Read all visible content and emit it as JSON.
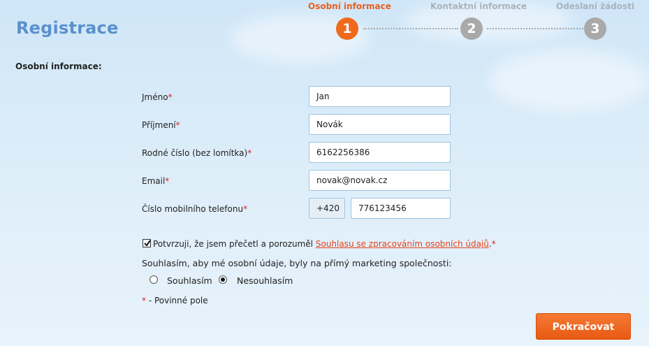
{
  "page": {
    "title": "Registrace"
  },
  "steps": [
    {
      "label": "Osobní informace",
      "number": "1",
      "state": "active"
    },
    {
      "label": "Kontaktní informace",
      "number": "2",
      "state": "inactive"
    },
    {
      "label": "Odeslaní žádosti",
      "number": "3",
      "state": "inactive"
    }
  ],
  "section": {
    "title": "Osobní informace:"
  },
  "form": {
    "first_name": {
      "label": "Jméno",
      "required_mark": "*",
      "value": "Jan"
    },
    "last_name": {
      "label": "Příjmení",
      "required_mark": "*",
      "value": "Novák"
    },
    "birth_number": {
      "label": "Rodné číslo (bez lomítka)",
      "required_mark": "*",
      "value": "6162256386"
    },
    "email": {
      "label": "Email",
      "required_mark": "*",
      "value": "novak@novak.cz"
    },
    "phone": {
      "label": "Číslo mobilního telefonu",
      "required_mark": "*",
      "prefix": "+420",
      "value": "776123456"
    }
  },
  "consent": {
    "checked": true,
    "text_before": "Potvrzuji, že jsem přečetl a porozuměl ",
    "link_text": "Souhlasu se zpracováním osobních údajů",
    "text_after": ".",
    "required_mark": "*"
  },
  "marketing": {
    "question": "Souhlasím, aby mé osobní údaje, byly na přímý marketing společnosti:",
    "options": [
      {
        "label": "Souhlasím",
        "selected": false
      },
      {
        "label": "Nesouhlasím",
        "selected": true
      }
    ]
  },
  "legend": {
    "mark": "*",
    "text": " - Povinné pole"
  },
  "actions": {
    "continue_label": "Pokračovat"
  },
  "colors": {
    "accent": "#f06a1d",
    "title_blue": "#5a91cc",
    "required_red": "#d9241c"
  }
}
